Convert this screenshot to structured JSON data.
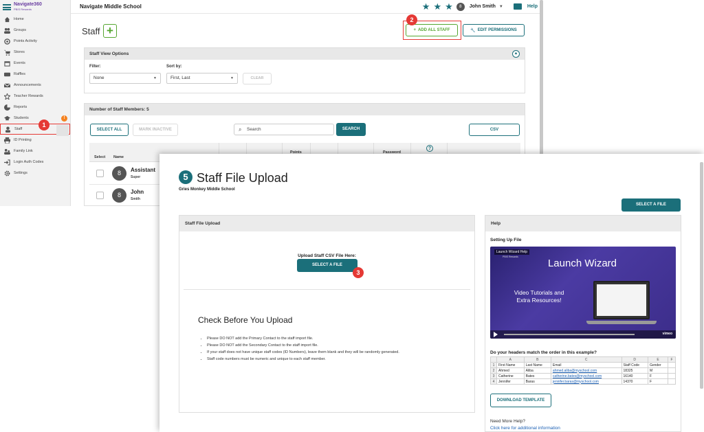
{
  "app": {
    "logo": "Navigate360",
    "logo_sub": "PBIS Rewards",
    "school_prefix": "Navigate",
    "school_name": "Middle School",
    "user_initial": "8",
    "user_name": "John Smith",
    "help": "Help"
  },
  "sidebar": {
    "items": [
      {
        "label": "Home",
        "icon": "home-icon"
      },
      {
        "label": "Groups",
        "icon": "groups-icon"
      },
      {
        "label": "Points Activity",
        "icon": "points-activity-icon"
      },
      {
        "label": "Stores",
        "icon": "cart-icon"
      },
      {
        "label": "Events",
        "icon": "calendar-icon"
      },
      {
        "label": "Raffles",
        "icon": "ticket-icon"
      },
      {
        "label": "Announcements",
        "icon": "mail-icon"
      },
      {
        "label": "Teacher Rewards",
        "icon": "star-icon"
      },
      {
        "label": "Reports",
        "icon": "pie-chart-icon"
      },
      {
        "label": "Students",
        "icon": "graduation-cap-icon"
      },
      {
        "label": "Staff",
        "icon": "person-icon"
      },
      {
        "label": "ID Printing",
        "icon": "printer-icon"
      },
      {
        "label": "Family Link",
        "icon": "family-icon"
      },
      {
        "label": "Login Auth Codes",
        "icon": "login-icon"
      },
      {
        "label": "Settings",
        "icon": "gear-icon"
      }
    ],
    "active": "Staff",
    "students_alert": "!"
  },
  "staff_page": {
    "title": "Staff",
    "add_all_staff": "ADD ALL STAFF",
    "edit_permissions": "EDIT PERMISSIONS",
    "view_options": {
      "title": "Staff View Options",
      "filter_label": "Filter:",
      "filter_value": "None",
      "sort_label": "Sort by:",
      "sort_value": "First, Last",
      "clear": "CLEAR"
    },
    "list": {
      "count_label": "Number of Staff Members: 5",
      "select_all": "SELECT ALL",
      "mark_inactive": "MARK INACTIVE",
      "search_placeholder": "Search",
      "search_button": "SEARCH",
      "csv": "CSV",
      "columns": [
        "Select",
        "Name",
        "Points",
        "Password"
      ],
      "help_mark": "?",
      "rows": [
        {
          "initial": "8",
          "name": "Assistant",
          "role": "Super"
        },
        {
          "initial": "8",
          "name": "John",
          "role": "Smith"
        }
      ]
    }
  },
  "markers": [
    "1",
    "2",
    "3"
  ],
  "upload_page": {
    "step": "5",
    "title": "Staff File Upload",
    "school": "Gries Monkey Middle School",
    "select_file_top": "SELECT A FILE",
    "panel_title": "Staff File Upload",
    "upload_label": "Upload Staff CSV File Here:",
    "select_file": "SELECT A FILE",
    "check_title": "Check Before You Upload",
    "bullets": [
      "Please DO NOT add the Primary Contact to the staff import file.",
      "Please DO NOT add the Secondary Contact to the staff import file.",
      "If your staff does not have unique staff codes (ID Numbers), leave them blank and they will be randomly generated.",
      "Staff code numbers must be numeric and unique to each staff member."
    ],
    "help": {
      "title": "Help",
      "subtitle": "Setting Up File",
      "video_chip": "Launch Wizard Help",
      "video_chip_sub": "PBIS Rewards",
      "video_title": "Launch Wizard",
      "video_text": "Video Tutorials and Extra Resources!",
      "video_brand": "vimeo",
      "question": "Do your headers match the order in this example?",
      "sheet_cols": [
        "",
        "A",
        "B",
        "C",
        "D",
        "E",
        "F"
      ],
      "sheet_rows": [
        [
          "1",
          "First Name",
          "Last Name",
          "Email",
          "Staff Code",
          "Gender",
          ""
        ],
        [
          "2",
          "Ahmed",
          "Aliba",
          "ahmed.aliba@myschool.com",
          "18325",
          "M",
          ""
        ],
        [
          "3",
          "Catherine",
          "Bates",
          "catherine.bates@myschool.com",
          "16140",
          "F",
          ""
        ],
        [
          "4",
          "Jennifer",
          "Baras",
          "jennifer.baras@myschool.com",
          "14370",
          "F",
          ""
        ]
      ],
      "download": "DOWNLOAD TEMPLATE",
      "need_help": "Need More Help?",
      "link": "Click here for additional information"
    }
  },
  "colors": {
    "teal": "#1b6f7a",
    "green": "#55a630",
    "marker_red": "#e53935",
    "alert_orange": "#f58220"
  }
}
